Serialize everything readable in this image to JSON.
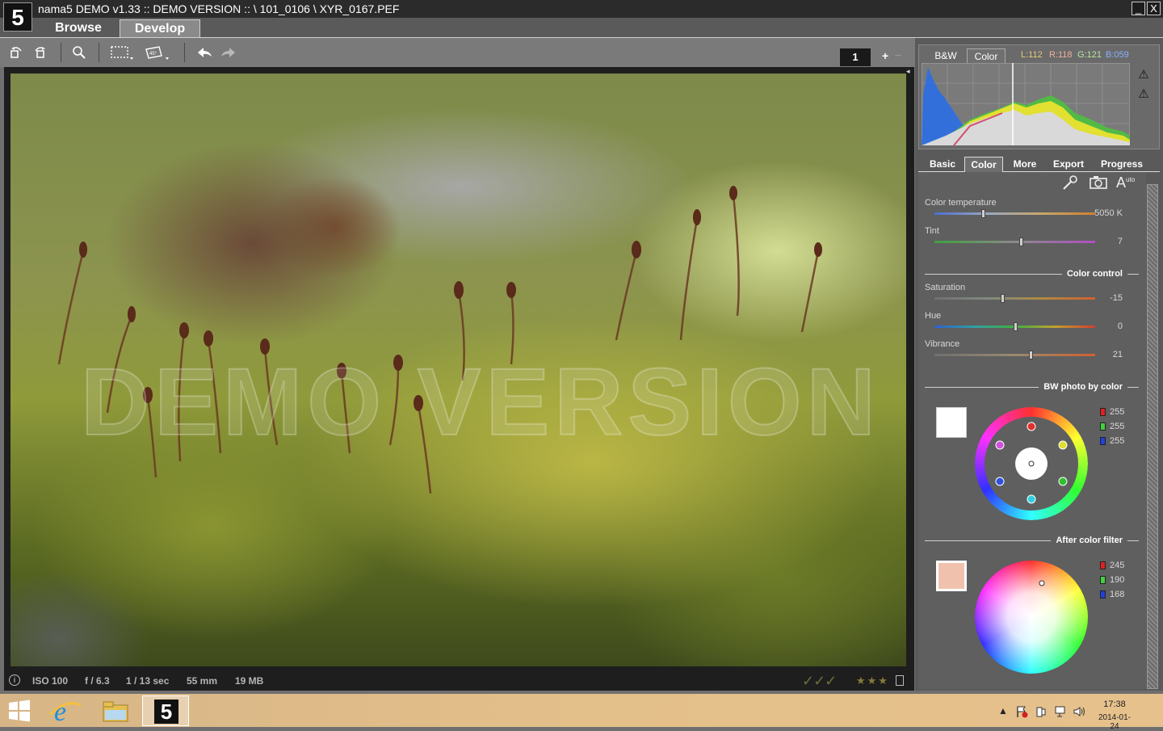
{
  "window": {
    "title": "nama5 DEMO v1.33 :: DEMO VERSION :: \\ 101_0106 \\ XYR_0167.PEF",
    "logo": "5",
    "minimize": "_",
    "close": "X"
  },
  "tabs": [
    {
      "label": "Browse"
    },
    {
      "label": "Develop",
      "active": true
    }
  ],
  "toolbar": {
    "icons": [
      "rotate-left-icon",
      "rotate-right-icon",
      "zoom-icon",
      "crop-icon",
      "straighten-icon",
      "undo-icon",
      "redo-icon"
    ],
    "page": "1",
    "zoom_plus": "+",
    "zoom_minus": "−"
  },
  "photo": {
    "watermark": "DEMO VERSION"
  },
  "status": {
    "iso": "ISO 100",
    "aperture": "f / 6.3",
    "shutter": "1 / 13 sec",
    "focal": "55 mm",
    "size": "19 MB",
    "checks": "✓✓✓",
    "stars": "★★★"
  },
  "histogram": {
    "tabs": [
      "B&W",
      "Color"
    ],
    "active_tab": "Color",
    "L": "L:112",
    "R": "R:118",
    "G": "G:121",
    "B": "B:059",
    "colors": {
      "L": "#e8c97a",
      "R": "#f0b0a0",
      "G": "#b8e6a0",
      "B": "#88b0ff"
    }
  },
  "settings_tabs": [
    "Basic",
    "Color",
    "More",
    "Export",
    "Progress"
  ],
  "active_settings_tab": "Color",
  "color_panel": {
    "auto_label": "A",
    "auto_sup": "uto",
    "temperature": {
      "label": "Color temperature",
      "value": "5050 K",
      "position": 0.3
    },
    "tint": {
      "label": "Tint",
      "value": "7",
      "position": 0.54
    },
    "section_color_control": "Color control",
    "saturation": {
      "label": "Saturation",
      "value": "-15",
      "position": 0.42
    },
    "hue": {
      "label": "Hue",
      "value": "0",
      "position": 0.5
    },
    "vibrance": {
      "label": "Vibrance",
      "value": "21",
      "position": 0.6
    },
    "section_bw": "BW photo by color",
    "bw_rgb": {
      "r": "255",
      "g": "255",
      "b": "255",
      "swatch": "#ffffff"
    },
    "section_filter": "After color filter",
    "filter_rgb": {
      "r": "245",
      "g": "190",
      "b": "168",
      "swatch": "#f0c2ae"
    }
  },
  "taskbar": {
    "apps": [
      "internet-explorer-icon",
      "file-explorer-icon",
      "nama5-app-icon"
    ],
    "nama5_label": "5",
    "time": "17:38",
    "date": "2014-01-24"
  }
}
